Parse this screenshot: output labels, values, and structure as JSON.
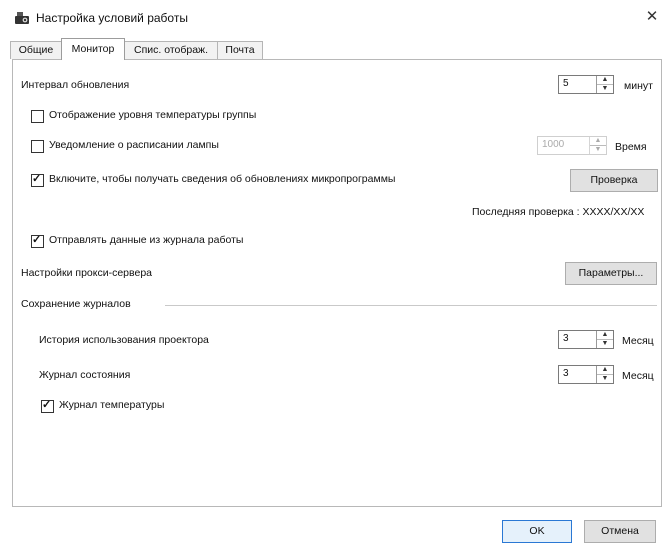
{
  "window": {
    "title": "Настройка условий работы",
    "close_symbol": "✕"
  },
  "tabs": [
    {
      "label": "Общие",
      "active": false
    },
    {
      "label": "Монитор",
      "active": true
    },
    {
      "label": "Спис. отображ.",
      "active": false
    },
    {
      "label": "Почта",
      "active": false
    }
  ],
  "monitor": {
    "update_interval": {
      "label": "Интервал обновления",
      "value": "5",
      "unit": "минут"
    },
    "group_temp_display": {
      "label": "Отображение уровня температуры группы",
      "checked": false
    },
    "lamp_schedule": {
      "label": "Уведомление о расписании лампы",
      "checked": false,
      "value": "1000",
      "unit": "Время"
    },
    "firmware_updates": {
      "label": "Включите, чтобы получать сведения об обновлениях микропрограммы",
      "checked": true,
      "button": "Проверка"
    },
    "last_check": "Последняя проверка : XXXX/XX/XX",
    "send_log": {
      "label": "Отправлять данные из журнала работы",
      "checked": true
    },
    "proxy": {
      "label": "Настройки прокси-сервера",
      "button": "Параметры..."
    },
    "logs_group": {
      "title": "Сохранение журналов",
      "usage_history": {
        "label": "История использования проектора",
        "value": "3",
        "unit": "Месяц"
      },
      "status_log": {
        "label": "Журнал состояния",
        "value": "3",
        "unit": "Месяц"
      },
      "temperature_log": {
        "label": "Журнал температуры",
        "checked": true
      }
    }
  },
  "footer": {
    "ok": "OK",
    "cancel": "Отмена"
  },
  "colors": {
    "accent": "#2a78d4",
    "button_face": "#e1e1e1",
    "border": "#adadad"
  }
}
